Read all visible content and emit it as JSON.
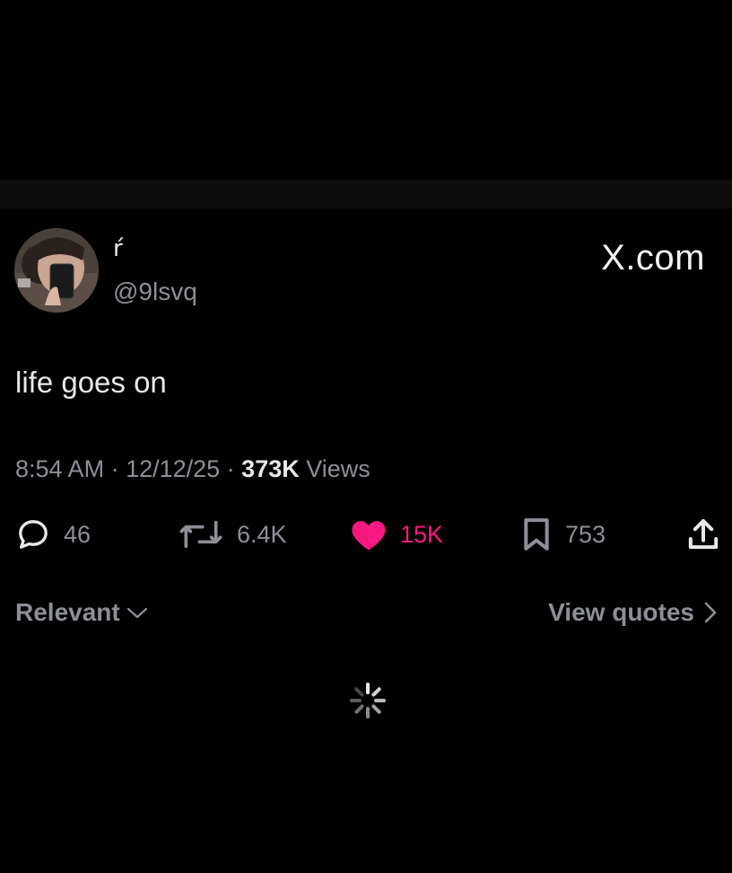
{
  "profile": {
    "display_name": "ŕ",
    "handle": "@9lsvq",
    "avatar": "avatar-photo"
  },
  "site_label": "X.com",
  "tweet": {
    "text": "life goes on"
  },
  "meta": {
    "time": "8:54 AM",
    "separator": " · ",
    "date": "12/12/25",
    "views_count": "373K",
    "views_label": " Views"
  },
  "actions": {
    "replies": {
      "icon": "reply-icon",
      "count": "46"
    },
    "reposts": {
      "icon": "repost-icon",
      "count": "6.4K"
    },
    "likes": {
      "icon": "heart-icon",
      "count": "15K",
      "liked": true,
      "color": "#f91880"
    },
    "bookmarks": {
      "icon": "bookmark-icon",
      "count": "753"
    },
    "share": {
      "icon": "share-icon"
    }
  },
  "replies_sort": {
    "label": "Relevant",
    "icon": "chevron-down-icon"
  },
  "view_quotes": {
    "label": "View quotes",
    "icon": "chevron-right-icon"
  },
  "loading": {
    "icon": "loading-spinner-icon"
  },
  "colors": {
    "background": "#000000",
    "text_primary": "#e7e9ea",
    "text_secondary": "#8b9096",
    "like": "#f91880"
  }
}
